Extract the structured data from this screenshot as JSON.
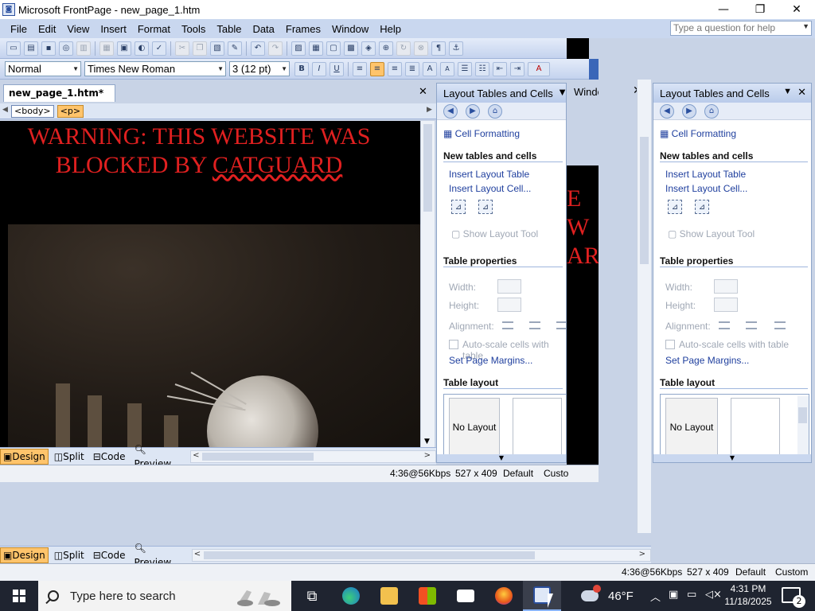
{
  "window": {
    "title": "Microsoft FrontPage - new_page_1.htm",
    "min": "—",
    "restore": "❐",
    "close": "✕"
  },
  "menu": [
    "File",
    "Edit",
    "View",
    "Insert",
    "Format",
    "Tools",
    "Table",
    "Data",
    "Frames",
    "Window",
    "Help"
  ],
  "help_placeholder": "Type a question for help",
  "format_toolbar": {
    "style": "Normal",
    "font": "Times New Roman",
    "size": "3 (12 pt)",
    "bold": "B",
    "italic": "I",
    "underline": "U",
    "size_up": "A",
    "size_down": "A",
    "font_color": "A"
  },
  "document": {
    "tab": "new_page_1.htm*",
    "close": "✕",
    "tags": [
      "<body>",
      "<p>"
    ],
    "warning_line1": "WARNING: THIS WEBSITE WAS",
    "warning_line2a": "BLOCKED BY ",
    "warning_line2b": "CATGUARD"
  },
  "views": [
    "Design",
    "Split",
    "Code",
    "Preview"
  ],
  "status": {
    "speed": "4:36@56Kbps",
    "size": "527 x 409",
    "mode": "Default",
    "custom": "Custom",
    "custom_cut": "Custo"
  },
  "back_window": {
    "label": "Winde",
    "text1": "E W",
    "text2": "ARI"
  },
  "task_pane": {
    "title": "Layout Tables and Cells",
    "cell_formatting": "Cell Formatting",
    "section_new": "New tables and cells",
    "insert_table": "Insert Layout Table",
    "insert_cell": "Insert Layout Cell...",
    "show_tool": "Show Layout Tool",
    "section_props": "Table properties",
    "width": "Width:",
    "height": "Height:",
    "alignment": "Alignment:",
    "autoscale": "Auto-scale cells with table",
    "margins": "Set Page Margins...",
    "section_layout": "Table layout",
    "no_layout": "No Layout"
  },
  "taskbar": {
    "search_placeholder": "Type here to search",
    "weather": "46°F",
    "time": "4:31 PM",
    "date": "11/18/2025",
    "notifications": "2"
  }
}
